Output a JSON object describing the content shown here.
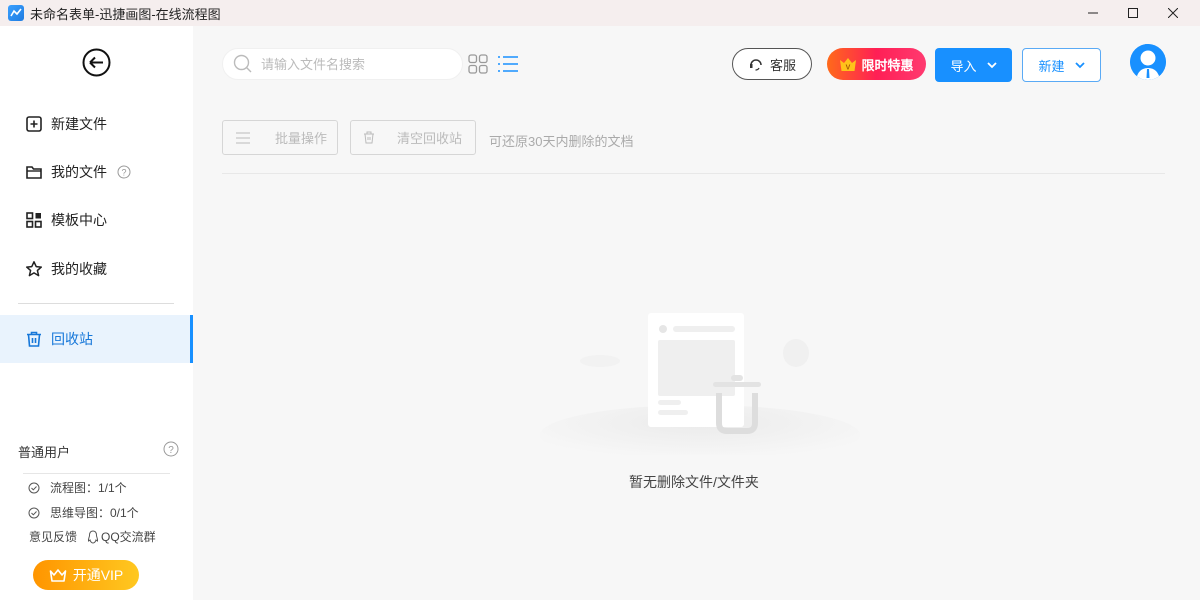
{
  "window": {
    "title": "未命名表单-迅捷画图-在线流程图"
  },
  "sidebar": {
    "items": [
      {
        "label": "新建文件",
        "icon": "plus-square-icon"
      },
      {
        "label": "我的文件",
        "icon": "folder-icon"
      },
      {
        "label": "模板中心",
        "icon": "grid-icon"
      },
      {
        "label": "我的收藏",
        "icon": "star-icon"
      },
      {
        "label": "回收站",
        "icon": "trash-icon",
        "active": true
      }
    ],
    "user_type": "普通用户",
    "quota": [
      {
        "label": "流程图：1/1个"
      },
      {
        "label": "思维导图：0/1个"
      }
    ],
    "feedback": "意见反馈",
    "qq_group": "QQ交流群",
    "vip_button": "开通VIP"
  },
  "header": {
    "search_placeholder": "请输入文件名搜索",
    "support": "客服",
    "promo": "限时特惠",
    "import": "导入",
    "new": "新建"
  },
  "toolbar": {
    "batch": "批量操作",
    "empty_bin": "清空回收站",
    "hint": "可还原30天内删除的文档"
  },
  "empty_state": {
    "text": "暂无删除文件/文件夹"
  },
  "colors": {
    "accent": "#1890ff",
    "vip": "#ffa40a",
    "promo": "#ff1f55"
  }
}
